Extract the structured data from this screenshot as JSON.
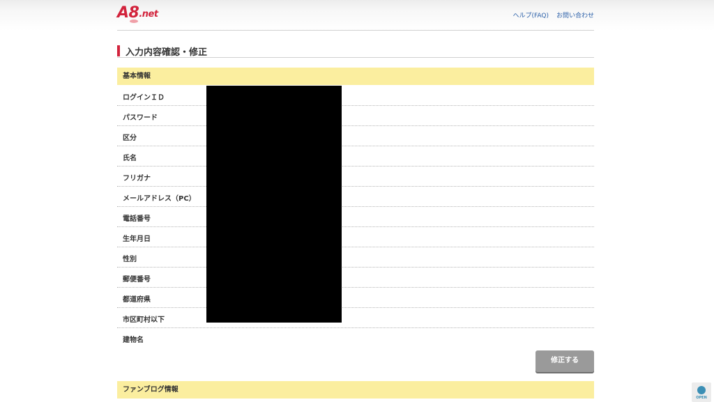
{
  "header": {
    "logo_main": "A8",
    "logo_sub": ".net",
    "links": [
      "ヘルプ(FAQ)",
      "お問い合わせ"
    ]
  },
  "page": {
    "title": "入力内容確認・修正"
  },
  "basic_info": {
    "heading": "基本情報",
    "fields": [
      "ログインＩＤ",
      "パスワード",
      "区分",
      "氏名",
      "フリガナ",
      "メールアドレス（PC）",
      "電話番号",
      "生年月日",
      "性別",
      "郵便番号",
      "都道府県",
      "市区町村以下",
      "建物名"
    ],
    "edit_button": "修正する"
  },
  "fan_blog": {
    "heading": "ファンブログ情報"
  },
  "corner_widget": {
    "label": "OPEN"
  },
  "colors": {
    "accent": "#d2233c",
    "section_bg": "#fbee9f",
    "link": "#2a5fa8",
    "button_bg": "#9a9a9a"
  }
}
